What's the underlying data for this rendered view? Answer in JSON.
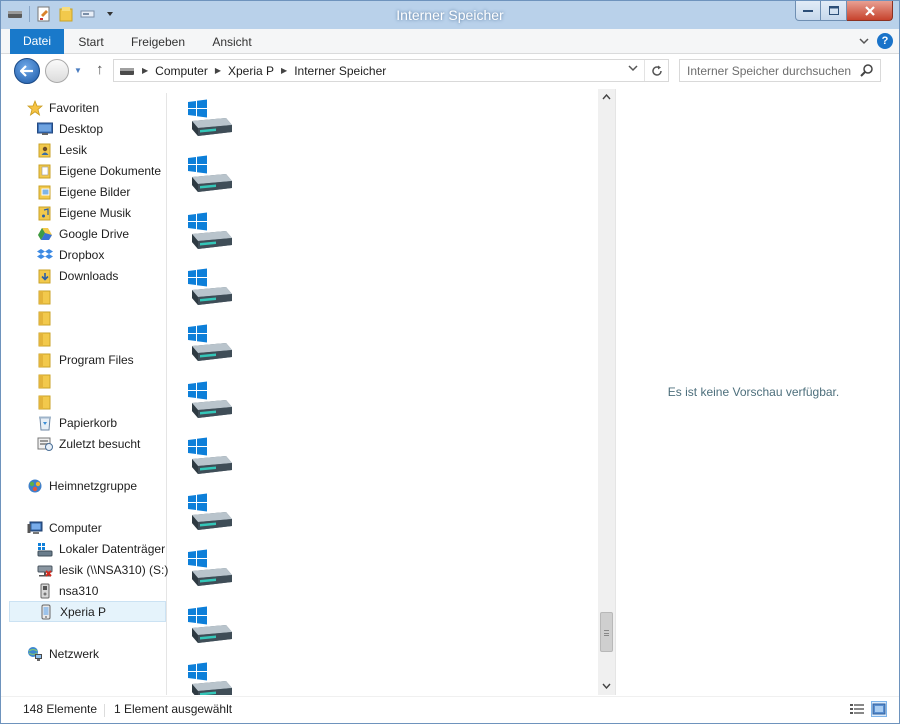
{
  "window": {
    "title": "Interner Speicher"
  },
  "ribbon": {
    "tabs": [
      {
        "label": "Datei"
      },
      {
        "label": "Start"
      },
      {
        "label": "Freigeben"
      },
      {
        "label": "Ansicht"
      }
    ]
  },
  "address": {
    "breadcrumbs": [
      "Computer",
      "Xperia P",
      "Interner Speicher"
    ]
  },
  "search": {
    "placeholder": "Interner Speicher durchsuchen"
  },
  "navpane": {
    "favorites": {
      "label": "Favoriten",
      "items": [
        {
          "label": "Desktop",
          "icon": "desktop-icon"
        },
        {
          "label": "Lesik",
          "icon": "user-folder-icon"
        },
        {
          "label": "Eigene Dokumente",
          "icon": "documents-folder-icon"
        },
        {
          "label": "Eigene Bilder",
          "icon": "pictures-folder-icon"
        },
        {
          "label": "Eigene Musik",
          "icon": "music-folder-icon"
        },
        {
          "label": "Google Drive",
          "icon": "google-drive-icon"
        },
        {
          "label": "Dropbox",
          "icon": "dropbox-icon"
        },
        {
          "label": "Downloads",
          "icon": "downloads-folder-icon"
        },
        {
          "label": "",
          "icon": "folder-icon"
        },
        {
          "label": "",
          "icon": "folder-icon"
        },
        {
          "label": "",
          "icon": "folder-icon"
        },
        {
          "label": "Program Files",
          "icon": "folder-icon"
        },
        {
          "label": "",
          "icon": "folder-icon"
        },
        {
          "label": "",
          "icon": "folder-icon"
        },
        {
          "label": "Papierkorb",
          "icon": "recycle-bin-icon"
        },
        {
          "label": "Zuletzt besucht",
          "icon": "recent-places-icon"
        }
      ]
    },
    "homegroup": {
      "label": "Heimnetzgruppe"
    },
    "computer": {
      "label": "Computer",
      "items": [
        {
          "label": "Lokaler Datenträger",
          "icon": "local-disk-icon"
        },
        {
          "label": "lesik (\\\\NSA310) (S:)",
          "icon": "network-drive-disconnected-icon"
        },
        {
          "label": "nsa310",
          "icon": "media-device-icon"
        },
        {
          "label": "Xperia P",
          "icon": "phone-icon"
        }
      ]
    },
    "network": {
      "label": "Netzwerk"
    }
  },
  "content": {
    "visible_item_icon": "windows-drive-icon",
    "visible_item_count": 11
  },
  "preview": {
    "message": "Es ist keine Vorschau verfügbar."
  },
  "status": {
    "item_count": "148 Elemente",
    "selection": "1 Element ausgewählt"
  }
}
